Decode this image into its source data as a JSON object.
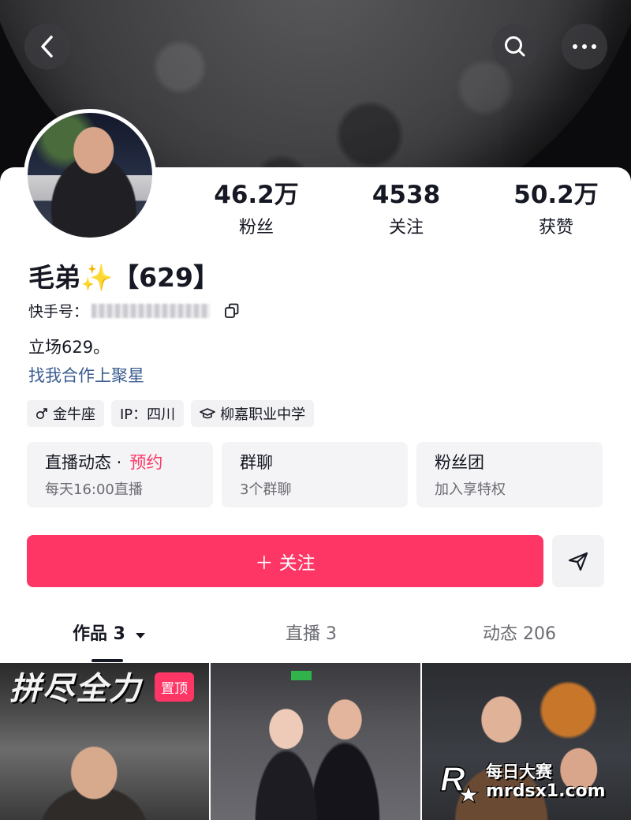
{
  "colors": {
    "accent": "#fe3666",
    "link": "#3a5c8f",
    "text_primary": "#161823",
    "text_secondary": "#6b6c73",
    "chip_bg": "#f2f2f4"
  },
  "header": {
    "icons": [
      "back-icon",
      "search-icon",
      "more-icon"
    ]
  },
  "profile": {
    "name": "毛弟✨【629】",
    "id_label": "快手号：",
    "bio": "立场629。",
    "bio_link": "找我合作上聚星",
    "tags": [
      {
        "icon": "male-icon",
        "label": "金牛座"
      },
      {
        "icon": "",
        "label": "IP：四川"
      },
      {
        "icon": "school-icon",
        "label": "柳嘉职业中学"
      }
    ]
  },
  "stats": [
    {
      "value": "46.2万",
      "label": "粉丝"
    },
    {
      "value": "4538",
      "label": "关注"
    },
    {
      "value": "50.2万",
      "label": "获赞"
    }
  ],
  "cards": [
    {
      "title": "直播动态 ·",
      "extra": "预约",
      "sub": "每天16:00直播"
    },
    {
      "title": "群聊",
      "sub": "3个群聊"
    },
    {
      "title": "粉丝团",
      "sub": "加入享特权"
    }
  ],
  "actions": {
    "follow_label": "＋ 关注",
    "share_icon": "send-icon"
  },
  "tabs": [
    {
      "label": "作品 3",
      "active": true
    },
    {
      "label": "直播 3",
      "active": false
    },
    {
      "label": "动态 206",
      "active": false
    }
  ],
  "videos": [
    {
      "overlay_text": "拼尽全力",
      "badge": "置顶"
    },
    {
      "overlay_text": "",
      "badge": ""
    },
    {
      "overlay_text": "",
      "badge": ""
    }
  ],
  "watermark": {
    "line1": "每日大赛",
    "line2": "mrdsx1.com"
  }
}
